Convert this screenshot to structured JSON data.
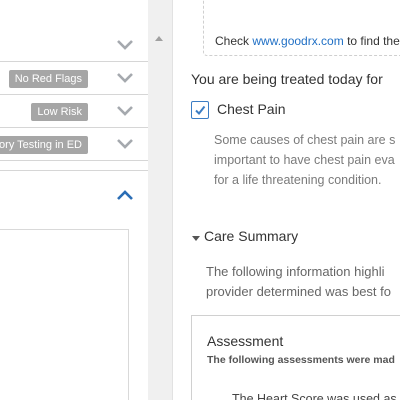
{
  "left_panel": {
    "accordion": [
      {
        "badge": ""
      },
      {
        "badge": "No Red Flags"
      },
      {
        "badge": "Low Risk"
      },
      {
        "badge": "tory Testing in ED"
      }
    ]
  },
  "right_panel": {
    "goodrx": {
      "prefix": "Check ",
      "link": "www.goodrx.com",
      "suffix": " to find the"
    },
    "treated_heading": "You are being treated today for",
    "condition": {
      "label": "Chest Pain",
      "checked": true
    },
    "causes_text": [
      "Some causes of chest pain are s",
      "important to have chest pain eva",
      "for a life threatening condition."
    ],
    "care_summary": {
      "title": "Care Summary",
      "description": [
        "The following information highli",
        "provider determined was best fo"
      ]
    },
    "assessment": {
      "title": "Assessment",
      "subtitle": "The following assessments were mad",
      "bullet": "The Heart Score was used as"
    }
  },
  "colors": {
    "link": "#1f6fc5",
    "accent_chevron": "#2a6db5",
    "badge": "#a6a6a6",
    "checkbox": "#3b7dc4"
  }
}
